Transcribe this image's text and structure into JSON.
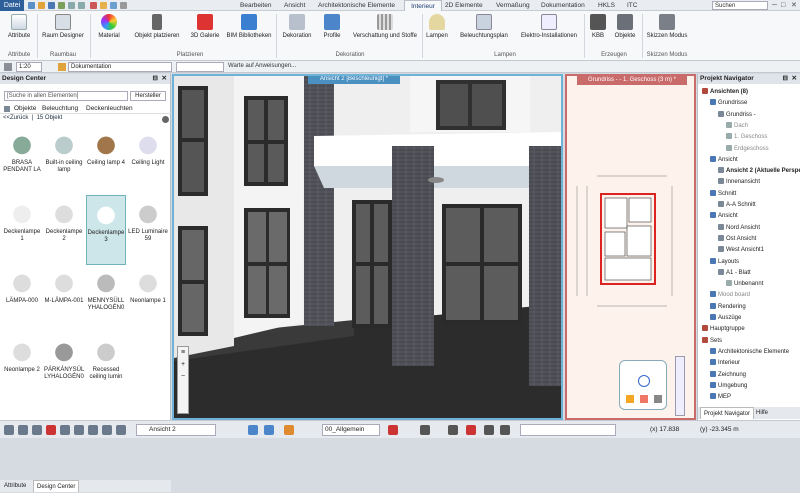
{
  "titlebar": {
    "file_tab": "Datei",
    "tabs": [
      "Bearbeiten",
      "Ansicht",
      "Architektonische Elemente",
      "Interieur",
      "2D Elemente",
      "Vermaßung",
      "Dokumentation",
      "HKLS",
      "ITC"
    ],
    "active_tab": "Interieur",
    "search_placeholder": "Suchen"
  },
  "ribbon": {
    "buttons": [
      {
        "label": "Attribute",
        "icon": "attribute-icon"
      },
      {
        "label": "Raum Designer",
        "icon": "room-designer-icon"
      },
      {
        "label": "Material",
        "icon": "material-icon"
      },
      {
        "label": "Objekt platzieren",
        "icon": "chair-icon"
      },
      {
        "label": "3D Galerie",
        "icon": "gallery-icon"
      },
      {
        "label": "BIM Bibliotheken",
        "icon": "download-icon"
      },
      {
        "label": "Dekoration",
        "icon": "decoration-icon"
      },
      {
        "label": "Profile",
        "icon": "profile-icon"
      },
      {
        "label": "Verschattung und Stoffe",
        "icon": "curtain-icon"
      },
      {
        "label": "Lampen",
        "icon": "lamp-icon"
      },
      {
        "label": "Beleuchtungsplan",
        "icon": "lighting-plan-icon"
      },
      {
        "label": "Elektro-Installationen",
        "icon": "electrical-icon"
      },
      {
        "label": "KBB",
        "icon": "kbb-icon"
      },
      {
        "label": "Objekte",
        "icon": "objects-icon"
      },
      {
        "label": "Skizzen Modus",
        "icon": "sketch-icon"
      }
    ],
    "groups": [
      "Attribute",
      "Raumbau",
      "Platzieren",
      "Dekoration",
      "Lampen",
      "Erzeugen",
      "Skizzen Modus"
    ]
  },
  "toolbar2": {
    "scale": "1:20",
    "layer": "Dokumentation",
    "prompt": "Warte auf Anweisungen..."
  },
  "design_center": {
    "title": "Design Center",
    "search_placeholder": "[Suche in allen Elementen]",
    "hersteller": "Hersteller",
    "tabs": [
      "Objekte",
      "Beleuchtung",
      "Deckenleuchten"
    ],
    "back": "<<Zurück",
    "count": "15 Objekt",
    "items": [
      {
        "label": "BRASA PENDANT LA"
      },
      {
        "label": "Built-in ceiling lamp"
      },
      {
        "label": "Ceiling lamp 4"
      },
      {
        "label": "Ceiling Light"
      },
      {
        "label": "Deckenlampe 1"
      },
      {
        "label": "Deckenlampe 2"
      },
      {
        "label": "Deckenlampe 3"
      },
      {
        "label": "LED Luminaire 59"
      },
      {
        "label": "LÄMPA-000"
      },
      {
        "label": "M-LÄMPA-001"
      },
      {
        "label": "MENNYSÜLL YHALOGÉN0"
      },
      {
        "label": "Neonlampe 1"
      },
      {
        "label": "Neonlampe 2"
      },
      {
        "label": "PÁRKÁNYSÜL LYHALOGÉN0"
      },
      {
        "label": "Recessed ceiling lumin"
      }
    ],
    "bottom_tabs": [
      "Attribute",
      "Design Center"
    ]
  },
  "view3d": {
    "title": "Ansicht 2 [Beschleunigt] *"
  },
  "plan": {
    "title": "Grundriss - - 1. Geschoss (3 m) *"
  },
  "navigator": {
    "title": "Projekt Navigator",
    "nodes": [
      {
        "label": "Ansichten (8)",
        "level": 0,
        "bold": true
      },
      {
        "label": "Grundrisse",
        "level": 1
      },
      {
        "label": "Grundriss -",
        "level": 2
      },
      {
        "label": "Dach",
        "level": 3,
        "muted": true
      },
      {
        "label": "1. Geschoss",
        "level": 3,
        "muted": true
      },
      {
        "label": "Erdgeschoss",
        "level": 3,
        "muted": true
      },
      {
        "label": "Ansicht",
        "level": 1
      },
      {
        "label": "Ansicht 2 (Aktuelle Perspe",
        "level": 2,
        "bold": true
      },
      {
        "label": "Innenansicht",
        "level": 2
      },
      {
        "label": "Schnitt",
        "level": 1
      },
      {
        "label": "A-A Schnitt",
        "level": 2
      },
      {
        "label": "Ansicht",
        "level": 1
      },
      {
        "label": "Nord Ansicht",
        "level": 2
      },
      {
        "label": "Ost Ansicht",
        "level": 2
      },
      {
        "label": "West Ansicht1",
        "level": 2
      },
      {
        "label": "Layouts",
        "level": 1
      },
      {
        "label": "A1 - Blatt",
        "level": 2
      },
      {
        "label": "Unbenannt",
        "level": 3
      },
      {
        "label": "Mood board",
        "level": 1,
        "muted": true
      },
      {
        "label": "Rendering",
        "level": 1
      },
      {
        "label": "Auszüge",
        "level": 1
      },
      {
        "label": "Hauptgruppe",
        "level": 0
      },
      {
        "label": "Sets",
        "level": 0
      },
      {
        "label": "Architektonische Elemente",
        "level": 1
      },
      {
        "label": "Interieur",
        "level": 1
      },
      {
        "label": "Zeichnung",
        "level": 1
      },
      {
        "label": "Umgebung",
        "level": 1
      },
      {
        "label": "MEP",
        "level": 1
      }
    ],
    "bottom_tabs": [
      "Projekt Navigator",
      "Hilfe"
    ]
  },
  "statusbar": {
    "view_select": "Ansicht 2",
    "layer_select": "00_Allgemein",
    "coord_x": "(x) 17.838",
    "coord_y": "(y) -23.345 m"
  }
}
